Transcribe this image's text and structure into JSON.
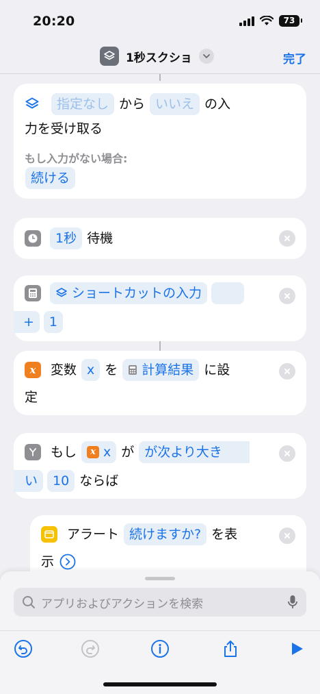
{
  "status": {
    "time": "20:20",
    "battery": "73"
  },
  "nav": {
    "title": "1秒スクショ",
    "done": "完了"
  },
  "cards": {
    "receive": {
      "t1": "指定なし",
      "t2": "から",
      "t3": "いいえ",
      "t4": "の入",
      "t5": "力を受け取る",
      "label": "もし入力がない場合:",
      "value": "続ける"
    },
    "wait": {
      "amount": "1秒",
      "text": "待機"
    },
    "calc": {
      "input": "ショートカットの入力",
      "operator": "+",
      "operand": "1"
    },
    "setvar": {
      "t1": "変数",
      "var": "x",
      "t2": "を",
      "value": "計算結果",
      "t3": "に設",
      "t4": "定"
    },
    "if": {
      "t1": "もし",
      "var": "x",
      "t2": "が",
      "cond1": "が次より大き",
      "cond2": "い",
      "num": "10",
      "t3": "ならば"
    },
    "alert": {
      "t1": "アラート",
      "msg": "続けますか?",
      "t2": "を表",
      "t3": "示"
    }
  },
  "search": {
    "placeholder": "アプリおよびアクションを検索"
  },
  "colors": {
    "accent": "#1a73e8",
    "variable": "#f0801f",
    "alert": "#f5c100",
    "gray_icon": "#8e8e93"
  }
}
